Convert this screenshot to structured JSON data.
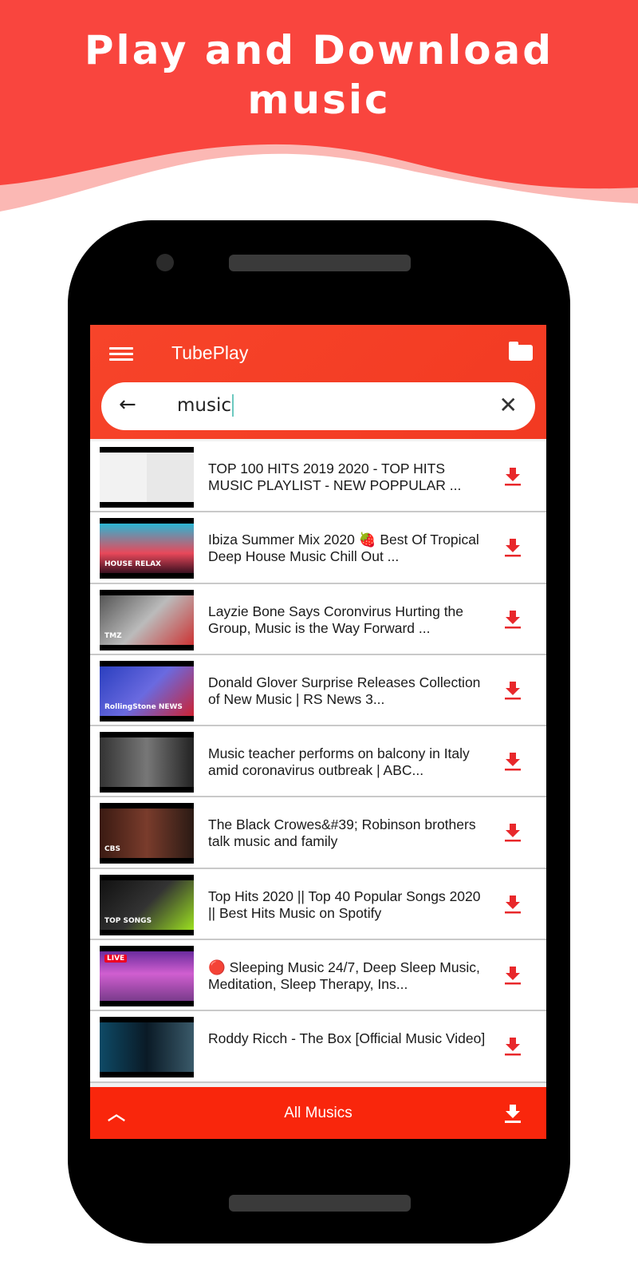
{
  "promo": {
    "line1": "Play and Download",
    "line2": "music"
  },
  "colors": {
    "brand": "#f7442a",
    "bottom_bar": "#f9260c",
    "download": "#e8282b"
  },
  "app": {
    "title": "TubePlay",
    "menu_icon": "hamburger-icon",
    "folder_icon": "folder-icon"
  },
  "search": {
    "value": "music",
    "back_icon": "arrow-left-icon",
    "clear_icon": "close-icon"
  },
  "results": [
    {
      "title": "TOP 100 HITS 2019 2020 - TOP HITS MUSIC PLAYLIST - NEW POPPULAR ...",
      "thumb_label": ""
    },
    {
      "title": "Ibiza Summer Mix 2020 🍓 Best Of Tropical Deep House Music Chill Out ...",
      "thumb_label": "HOUSE  RELAX"
    },
    {
      "title": "Layzie Bone Says Coronvirus Hurting the Group, Music is the Way Forward ...",
      "thumb_label": "TMZ"
    },
    {
      "title": "Donald Glover Surprise Releases Collection of New Music | RS News 3...",
      "thumb_label": "RollingStone NEWS"
    },
    {
      "title": "Music teacher performs on balcony in Italy amid coronavirus outbreak | ABC...",
      "thumb_label": ""
    },
    {
      "title": "The Black Crowes&#39; Robinson brothers talk music and family",
      "thumb_label": "CBS"
    },
    {
      "title": "Top Hits 2020 || Top 40 Popular Songs 2020 || Best Hits Music on Spotify",
      "thumb_label": "TOP SONGS"
    },
    {
      "title": "🔴 Sleeping Music 24/7, Deep Sleep Music, Meditation, Sleep Therapy, Ins...",
      "thumb_label": "LIVE"
    },
    {
      "title": "Roddy Ricch - The Box [Official Music Video]",
      "thumb_label": ""
    }
  ],
  "bottom_bar": {
    "label": "All Musics",
    "expand_icon": "chevron-up-icon",
    "download_icon": "download-icon"
  }
}
